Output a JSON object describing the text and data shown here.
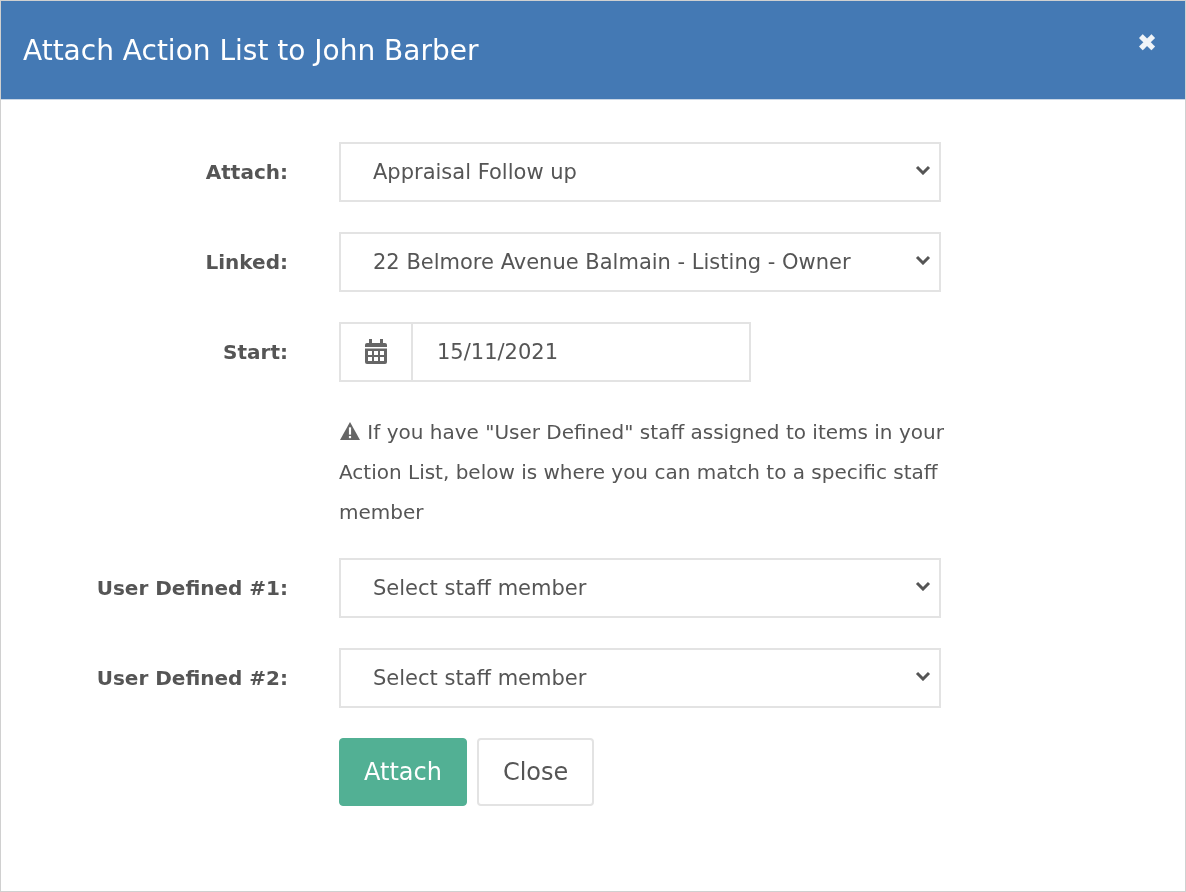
{
  "dialog": {
    "title": "Attach Action List to John Barber",
    "close": "✖"
  },
  "fields": [
    {
      "label": "Attach:",
      "kind": "select",
      "value": "Appraisal Follow up"
    },
    {
      "label": "Linked:",
      "kind": "select",
      "value": "22 Belmore Avenue Balmain - Listing - Owner"
    },
    {
      "label": "Start:",
      "kind": "date",
      "value": "15/11/2021"
    }
  ],
  "notice": "If you have \"User Defined\" staff assigned to items in your Action List, below is where you can match to a specific staff member",
  "staff_fields": [
    {
      "label": "User Defined #1:",
      "kind": "select",
      "value": "Select staff member"
    },
    {
      "label": "User Defined #2:",
      "kind": "select",
      "value": "Select staff member"
    }
  ],
  "buttons": [
    {
      "label": "Attach",
      "kind": "primary"
    },
    {
      "label": "Close",
      "kind": "default"
    }
  ]
}
